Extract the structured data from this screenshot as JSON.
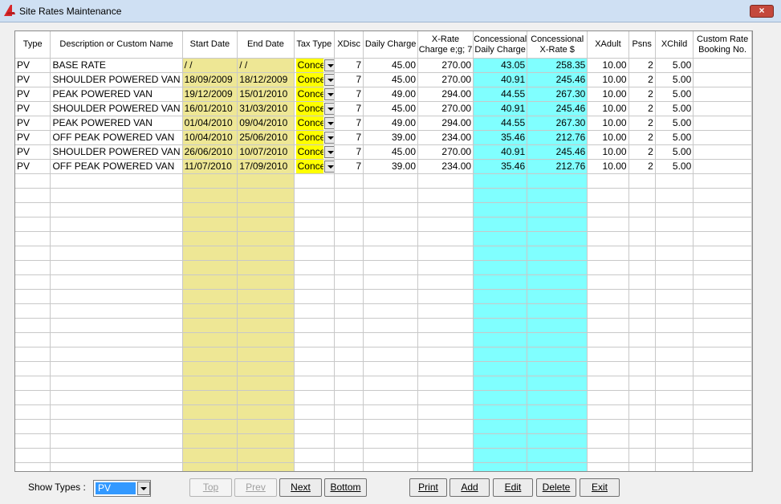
{
  "window": {
    "title": "Site Rates Maintenance",
    "close_label": "×"
  },
  "columns": [
    "Type",
    "Description or Custom Name",
    "Start Date",
    "End Date",
    "Tax Type",
    "XDisc",
    "Daily Charge",
    "X-Rate Charge e;g; 7",
    "Concessional Daily Charge",
    "Concessional X-Rate $",
    "XAdult",
    "Psns",
    "XChild",
    "Custom Rate Booking No."
  ],
  "rows": [
    {
      "type": "PV",
      "desc": "BASE RATE",
      "start": "/  /",
      "end": "/  /",
      "tax": "Concess",
      "xdisc": "7",
      "daily": "45.00",
      "xrate": "270.00",
      "cdaily": "43.05",
      "cxrate": "258.35",
      "xadult": "10.00",
      "psns": "2",
      "xchild": "5.00",
      "booking": ""
    },
    {
      "type": "PV",
      "desc": "SHOULDER POWERED VAN",
      "start": "18/09/2009",
      "end": "18/12/2009",
      "tax": "Concess",
      "xdisc": "7",
      "daily": "45.00",
      "xrate": "270.00",
      "cdaily": "40.91",
      "cxrate": "245.46",
      "xadult": "10.00",
      "psns": "2",
      "xchild": "5.00",
      "booking": ""
    },
    {
      "type": "PV",
      "desc": "PEAK POWERED VAN",
      "start": "19/12/2009",
      "end": "15/01/2010",
      "tax": "Concess",
      "xdisc": "7",
      "daily": "49.00",
      "xrate": "294.00",
      "cdaily": "44.55",
      "cxrate": "267.30",
      "xadult": "10.00",
      "psns": "2",
      "xchild": "5.00",
      "booking": ""
    },
    {
      "type": "PV",
      "desc": "SHOULDER POWERED VAN",
      "start": "16/01/2010",
      "end": "31/03/2010",
      "tax": "Concess",
      "xdisc": "7",
      "daily": "45.00",
      "xrate": "270.00",
      "cdaily": "40.91",
      "cxrate": "245.46",
      "xadult": "10.00",
      "psns": "2",
      "xchild": "5.00",
      "booking": ""
    },
    {
      "type": "PV",
      "desc": "PEAK POWERED VAN",
      "start": "01/04/2010",
      "end": "09/04/2010",
      "tax": "Concess",
      "xdisc": "7",
      "daily": "49.00",
      "xrate": "294.00",
      "cdaily": "44.55",
      "cxrate": "267.30",
      "xadult": "10.00",
      "psns": "2",
      "xchild": "5.00",
      "booking": ""
    },
    {
      "type": "PV",
      "desc": "OFF PEAK POWERED VAN",
      "start": "10/04/2010",
      "end": "25/06/2010",
      "tax": "Concess",
      "xdisc": "7",
      "daily": "39.00",
      "xrate": "234.00",
      "cdaily": "35.46",
      "cxrate": "212.76",
      "xadult": "10.00",
      "psns": "2",
      "xchild": "5.00",
      "booking": ""
    },
    {
      "type": "PV",
      "desc": "SHOULDER POWERED VAN",
      "start": "26/06/2010",
      "end": "10/07/2010",
      "tax": "Concess",
      "xdisc": "7",
      "daily": "45.00",
      "xrate": "270.00",
      "cdaily": "40.91",
      "cxrate": "245.46",
      "xadult": "10.00",
      "psns": "2",
      "xchild": "5.00",
      "booking": ""
    },
    {
      "type": "PV",
      "desc": "OFF PEAK POWERED VAN",
      "start": "11/07/2010",
      "end": "17/09/2010",
      "tax": "Concess",
      "xdisc": "7",
      "daily": "39.00",
      "xrate": "234.00",
      "cdaily": "35.46",
      "cxrate": "212.76",
      "xadult": "10.00",
      "psns": "2",
      "xchild": "5.00",
      "booking": ""
    }
  ],
  "colors": {
    "date_bg": "#eee795",
    "tax_bg": "#ffff00",
    "conc_bg": "#80ffff"
  },
  "filter": {
    "label": "Show Types :",
    "value": "PV"
  },
  "buttons": {
    "top": "Top",
    "prev": "Prev",
    "next": "Next",
    "bottom": "Bottom",
    "print": "Print",
    "add": "Add",
    "edit": "Edit",
    "delete": "Delete",
    "exit": "Exit"
  }
}
